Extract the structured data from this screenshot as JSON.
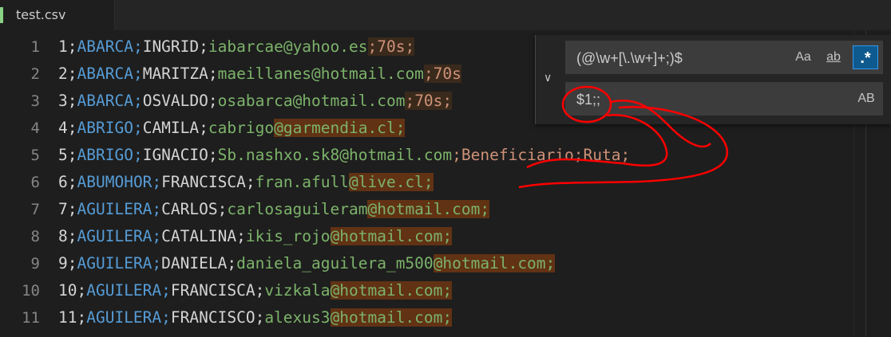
{
  "tab": {
    "filename": "test.csv"
  },
  "editor": {
    "lines": [
      {
        "num": "1",
        "id": "1",
        "last": "ABARCA",
        "first": "INGRID",
        "email_user": "iabarcae",
        "email_domain": "@yahoo.es",
        "extra": ";70s;",
        "match": false
      },
      {
        "num": "2",
        "id": "2",
        "last": "ABARCA",
        "first": "MARITZA",
        "email_user": "maeillanes",
        "email_domain": "@hotmail.com",
        "extra": ";70s",
        "match": false
      },
      {
        "num": "3",
        "id": "3",
        "last": "ABARCA",
        "first": "OSVALDO",
        "email_user": "osabarca",
        "email_domain": "@hotmail.com",
        "extra": ";70s;",
        "match": false
      },
      {
        "num": "4",
        "id": "4",
        "last": "ABRIGO",
        "first": "CAMILA",
        "email_user": "cabrigo",
        "email_domain": "@garmendia.cl;",
        "extra": "",
        "match": true
      },
      {
        "num": "5",
        "id": "5",
        "last": "ABRIGO",
        "first": "IGNACIO",
        "email_user": "Sb.nashxo.sk8",
        "email_domain": "@hotmail.com",
        "extra": ";Beneficiario;Ruta;",
        "match": false
      },
      {
        "num": "6",
        "id": "6",
        "last": "ABUMOHOR",
        "first": "FRANCISCA",
        "email_user": "fran.afull",
        "email_domain": "@live.cl;",
        "extra": "",
        "match": true
      },
      {
        "num": "7",
        "id": "7",
        "last": "AGUILERA",
        "first": "CARLOS",
        "email_user": "carlosaguileram",
        "email_domain": "@hotmail.com;",
        "extra": "",
        "match": true
      },
      {
        "num": "8",
        "id": "8",
        "last": "AGUILERA",
        "first": "CATALINA",
        "email_user": "ikis_rojo",
        "email_domain": "@hotmail.com;",
        "extra": "",
        "match": true
      },
      {
        "num": "9",
        "id": "9",
        "last": "AGUILERA",
        "first": "DANIELA",
        "email_user": "daniela_aguilera_m500",
        "email_domain": "@hotmail.com;",
        "extra": "",
        "match": true
      },
      {
        "num": "10",
        "id": "10",
        "last": "AGUILERA",
        "first": "FRANCISCA",
        "email_user": "vizkala",
        "email_domain": "@hotmail.com;",
        "extra": "",
        "match": true
      },
      {
        "num": "11",
        "id": "11",
        "last": "AGUILERA",
        "first": "FRANCISCO",
        "email_user": "alexus3",
        "email_domain": "@hotmail.com;",
        "extra": "",
        "match": true
      }
    ]
  },
  "find_widget": {
    "find_value": "(@\\w+[\\.\\w+]+;)$",
    "replace_value": "$1;;",
    "match_case_label": "Aa",
    "whole_word_label": "ab",
    "regex_label": ".*",
    "preserve_case_label": "AB",
    "toggle_icon": "chevron-down-icon"
  },
  "colors": {
    "background": "#1e1e1e",
    "match_highlight": "#613214",
    "annotation": "#ff0000"
  }
}
